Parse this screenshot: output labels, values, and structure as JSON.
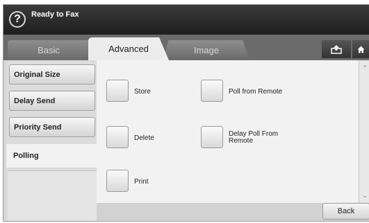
{
  "status": {
    "help_glyph": "?",
    "text": "Ready to Fax"
  },
  "tabs": [
    {
      "label": "Basic",
      "selected": false
    },
    {
      "label": "Advanced",
      "selected": true
    },
    {
      "label": "Image",
      "selected": false
    }
  ],
  "toolbar_icons": {
    "upload": "upload-icon",
    "home": "home-icon"
  },
  "sidebar": {
    "items": [
      {
        "label": "Original Size"
      },
      {
        "label": "Delay Send"
      },
      {
        "label": "Priority Send"
      },
      {
        "label": "Polling",
        "selected": true
      }
    ]
  },
  "options": [
    {
      "label": "Store"
    },
    {
      "label": "Delete"
    },
    {
      "label": "Print"
    },
    {
      "label": "Poll from Remote"
    },
    {
      "label_line1": "Delay Poll From",
      "label_line2": "Remote"
    }
  ],
  "footer": {
    "back_label": "Back"
  },
  "colors": {
    "status_bar": "#2a2a2a",
    "tab_bar": "#6b6b6b",
    "panel": "#f2f2f2"
  }
}
